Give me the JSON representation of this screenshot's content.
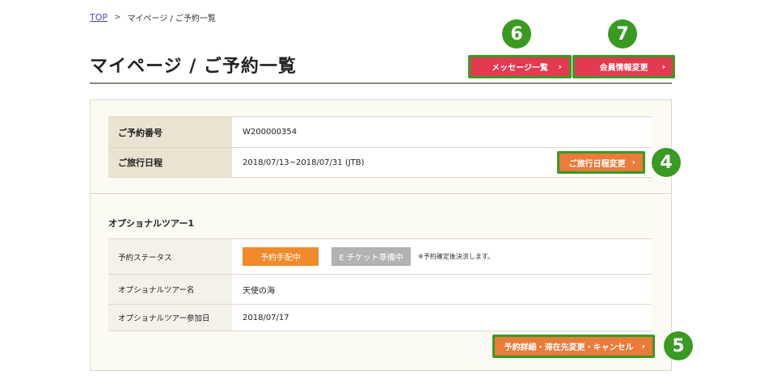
{
  "breadcrumb": {
    "home": "TOP",
    "separator": ">",
    "current": "マイページ / ご予約一覧"
  },
  "page_title": "マイページ / ご予約一覧",
  "header_buttons": {
    "messages": {
      "label": "メッセージ一覧",
      "marker": "6"
    },
    "member_info": {
      "label": "会員情報変更",
      "marker": "7"
    }
  },
  "reservation": {
    "number_label": "ご予約番号",
    "number_value": "W200000354",
    "schedule_label": "ご旅行日程",
    "schedule_value": "2018/07/13~2018/07/31 (JTB)",
    "change_button": {
      "label": "ご旅行日程変更",
      "marker": "4"
    }
  },
  "optional_tour": {
    "section_title": "オプショナルツアー1",
    "status_label": "予約ステータス",
    "status_active": "予約手配中",
    "status_inactive": "E チケット準備中",
    "status_note": "※予約確定後決済します。",
    "name_label": "オプショナルツアー名",
    "name_value": "天使の海",
    "date_label": "オプショナルツアー参加日",
    "date_value": "2018/07/17",
    "detail_button": {
      "label": "予約詳細・滞在先変更・キャンセル",
      "marker": "5"
    }
  },
  "icons": {
    "chevron": "chevron-right-icon",
    "breadcrumb_separator": "chevron-right-icon"
  },
  "colors": {
    "red_button": "#e23a50",
    "orange_button": "#ea7b3a",
    "status_orange": "#f08a2a",
    "highlight_green": "#3a9a22",
    "header_cell": "#e9e4d2"
  }
}
